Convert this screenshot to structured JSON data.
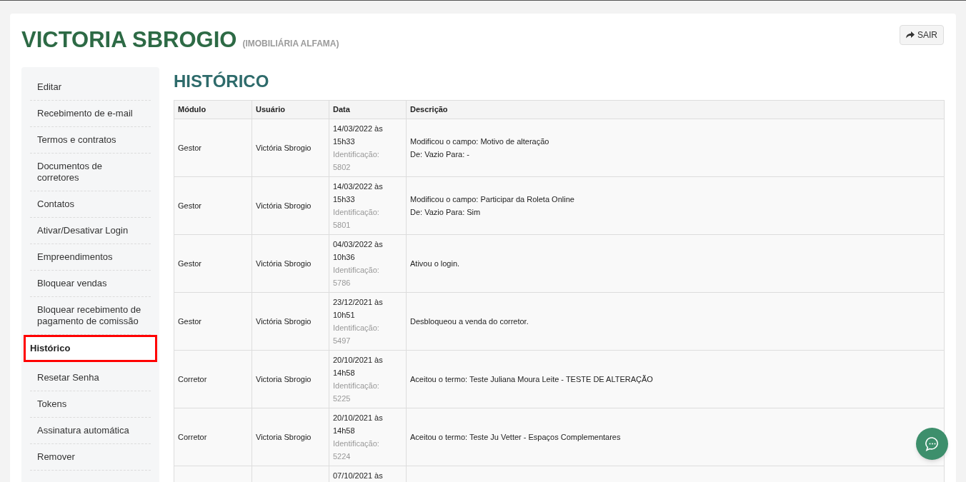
{
  "header": {
    "name": "VICTORIA SBROGIO",
    "company": "(IMOBILIÁRIA ALFAMA)",
    "logout_button": "SAIR"
  },
  "sidebar": {
    "items": [
      {
        "label": "Editar",
        "selected": false
      },
      {
        "label": "Recebimento de e-mail",
        "selected": false
      },
      {
        "label": "Termos e contratos",
        "selected": false
      },
      {
        "label": "Documentos de corretores",
        "selected": false
      },
      {
        "label": "Contatos",
        "selected": false
      },
      {
        "label": "Ativar/Desativar Login",
        "selected": false
      },
      {
        "label": "Empreendimentos",
        "selected": false
      },
      {
        "label": "Bloquear vendas",
        "selected": false
      },
      {
        "label": "Bloquear recebimento de\npagamento de comissão",
        "selected": false
      },
      {
        "label": "Histórico",
        "selected": true
      },
      {
        "label": "Resetar Senha",
        "selected": false
      },
      {
        "label": "Tokens",
        "selected": false
      },
      {
        "label": "Assinatura automática",
        "selected": false
      },
      {
        "label": "Remover",
        "selected": false
      }
    ]
  },
  "section_title": "HISTÓRICO",
  "table": {
    "columns": [
      "Módulo",
      "Usuário",
      "Data",
      "Descrição"
    ],
    "rows": [
      {
        "module": "Gestor",
        "user": "Victória Sbrogio",
        "date": "14/03/2022 às 15h33",
        "identification": "Identificação: 5802",
        "description": [
          "Modificou o campo: Motivo de alteração",
          "De: Vazio Para: -"
        ]
      },
      {
        "module": "Gestor",
        "user": "Victória Sbrogio",
        "date": "14/03/2022 às 15h33",
        "identification": "Identificação: 5801",
        "description": [
          "Modificou o campo: Participar da Roleta Online",
          "De: Vazio Para: Sim"
        ]
      },
      {
        "module": "Gestor",
        "user": "Victória Sbrogio",
        "date": "04/03/2022 às 10h36",
        "identification": "Identificação: 5786",
        "description": [
          "Ativou o login."
        ]
      },
      {
        "module": "Gestor",
        "user": "Victória Sbrogio",
        "date": "23/12/2021 às 10h51",
        "identification": "Identificação: 5497",
        "description": [
          "Desbloqueou a venda do corretor."
        ]
      },
      {
        "module": "Corretor",
        "user": "Victoria Sbrogio",
        "date": "20/10/2021 às 14h58",
        "identification": "Identificação: 5225",
        "description": [
          "Aceitou o termo: Teste Juliana Moura Leite - TESTE DE ALTERAÇÃO"
        ]
      },
      {
        "module": "Corretor",
        "user": "Victoria Sbrogio",
        "date": "20/10/2021 às 14h58",
        "identification": "Identificação: 5224",
        "description": [
          "Aceitou o termo: Teste Ju Vetter - Espaços Complementares"
        ]
      },
      {
        "date": "07/10/2021 às"
      }
    ]
  }
}
